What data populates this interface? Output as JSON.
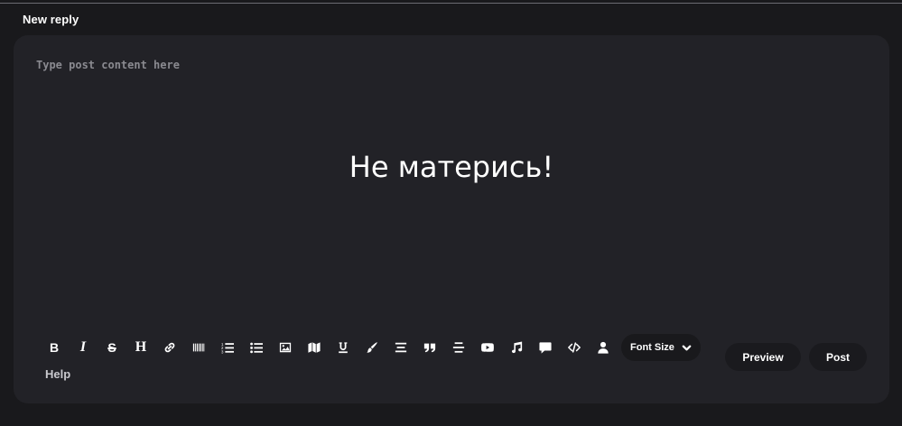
{
  "section": {
    "title": "New reply"
  },
  "editor": {
    "placeholder": "Type post content here",
    "overlay_message": "Не матерись!"
  },
  "toolbar": {
    "buttons": [
      {
        "name": "bold-icon",
        "glyph": "B"
      },
      {
        "name": "italic-icon",
        "glyph": "I"
      },
      {
        "name": "strikethrough-icon",
        "glyph": "S"
      },
      {
        "name": "heading-icon",
        "glyph": "H"
      },
      {
        "name": "link-icon"
      },
      {
        "name": "barcode-icon"
      },
      {
        "name": "ordered-list-icon"
      },
      {
        "name": "unordered-list-icon"
      },
      {
        "name": "image-icon"
      },
      {
        "name": "map-icon"
      },
      {
        "name": "underline-icon"
      },
      {
        "name": "paint-brush-icon"
      },
      {
        "name": "align-center-icon"
      },
      {
        "name": "quote-icon"
      },
      {
        "name": "align-justify-icon"
      },
      {
        "name": "youtube-icon"
      },
      {
        "name": "music-icon"
      },
      {
        "name": "comment-icon"
      },
      {
        "name": "code-icon"
      },
      {
        "name": "user-icon"
      }
    ],
    "font_size_label": "Font Size"
  },
  "help_label": "Help",
  "actions": {
    "preview_label": "Preview",
    "post_label": "Post"
  },
  "colors": {
    "page_bg": "#19191c",
    "card_bg": "#222227",
    "pill_bg": "#1a1a1e"
  }
}
